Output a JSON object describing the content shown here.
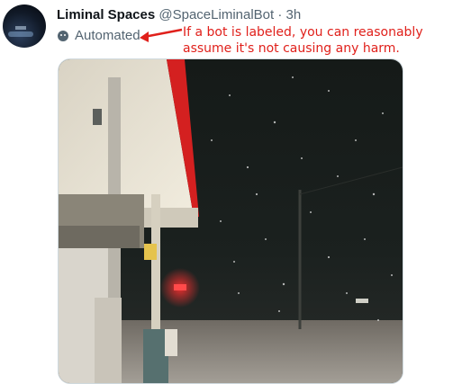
{
  "tweet": {
    "display_name": "Liminal Spaces",
    "handle": "@SpaceLiminalBot",
    "separator": "·",
    "time": "3h",
    "automated_label": "Automated",
    "bot_icon": "robot-icon"
  },
  "annotation": {
    "line1": "If a bot is labeled, you can reasonably",
    "line2": "assume it's not causing any harm.",
    "color": "#e0201b"
  },
  "media": {
    "description_icon": "night-gas-station-photo"
  }
}
